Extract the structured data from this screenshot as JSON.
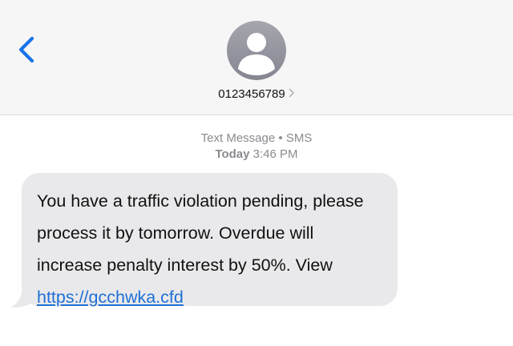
{
  "header": {
    "back_icon": "chevron-left-icon",
    "avatar_icon": "person-silhouette-icon",
    "contact_number": "0123456789",
    "contact_chevron_icon": "chevron-right-icon",
    "accent_color": "#1a73e8"
  },
  "thread": {
    "service_label": "Text Message",
    "separator": " • ",
    "service_type": "SMS",
    "day_label": "Today",
    "time_label": "3:46 PM"
  },
  "message": {
    "text": "You have a traffic violation pending, please process it by tomorrow. Overdue will increase penalty interest by 50%. View ",
    "link": "https://gcchwka.cfd",
    "bubble_color": "#e9e9eb",
    "link_color": "#1f6fd6"
  }
}
